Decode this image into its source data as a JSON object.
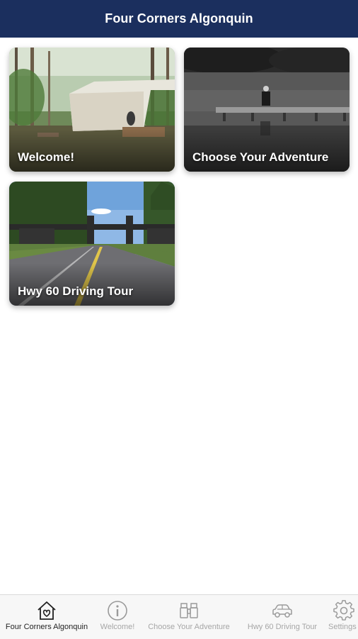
{
  "header": {
    "title": "Four Corners Algonquin"
  },
  "cards": [
    {
      "label": "Welcome!"
    },
    {
      "label": "Choose Your Adventure"
    },
    {
      "label": "Hwy 60 Driving Tour"
    }
  ],
  "tabs": [
    {
      "label": "Four Corners Algonquin",
      "icon": "home-heart-icon",
      "active": true
    },
    {
      "label": "Welcome!",
      "icon": "info-icon",
      "active": false
    },
    {
      "label": "Choose Your Adventure",
      "icon": "binoculars-icon",
      "active": false
    },
    {
      "label": "Hwy 60 Driving Tour",
      "icon": "car-icon",
      "active": false
    },
    {
      "label": "Settings",
      "icon": "gear-icon",
      "active": false
    }
  ],
  "colors": {
    "header_bg": "#1b2f5e",
    "active_tab": "#1f1f1f",
    "inactive_tab": "#a6a6a6"
  }
}
